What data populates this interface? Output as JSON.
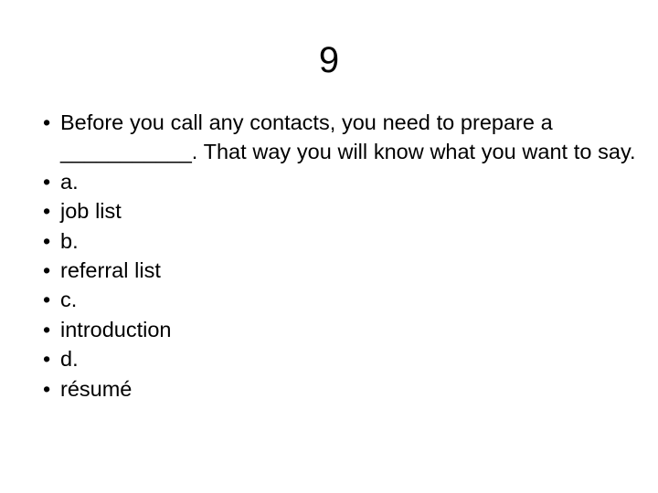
{
  "slide": {
    "title": "9",
    "bullet_glyph": "•",
    "items": [
      {
        "text": "Before you call any contacts, you need to prepare a ___________. That way you will know what you want to say."
      },
      {
        "text": "a."
      },
      {
        "text": "job list"
      },
      {
        "text": "b."
      },
      {
        "text": "referral list"
      },
      {
        "text": "c."
      },
      {
        "text": "introduction"
      },
      {
        "text": "d."
      },
      {
        "text": "résumé"
      }
    ]
  },
  "colors": {
    "background": "#ffffff",
    "text": "#000000"
  }
}
